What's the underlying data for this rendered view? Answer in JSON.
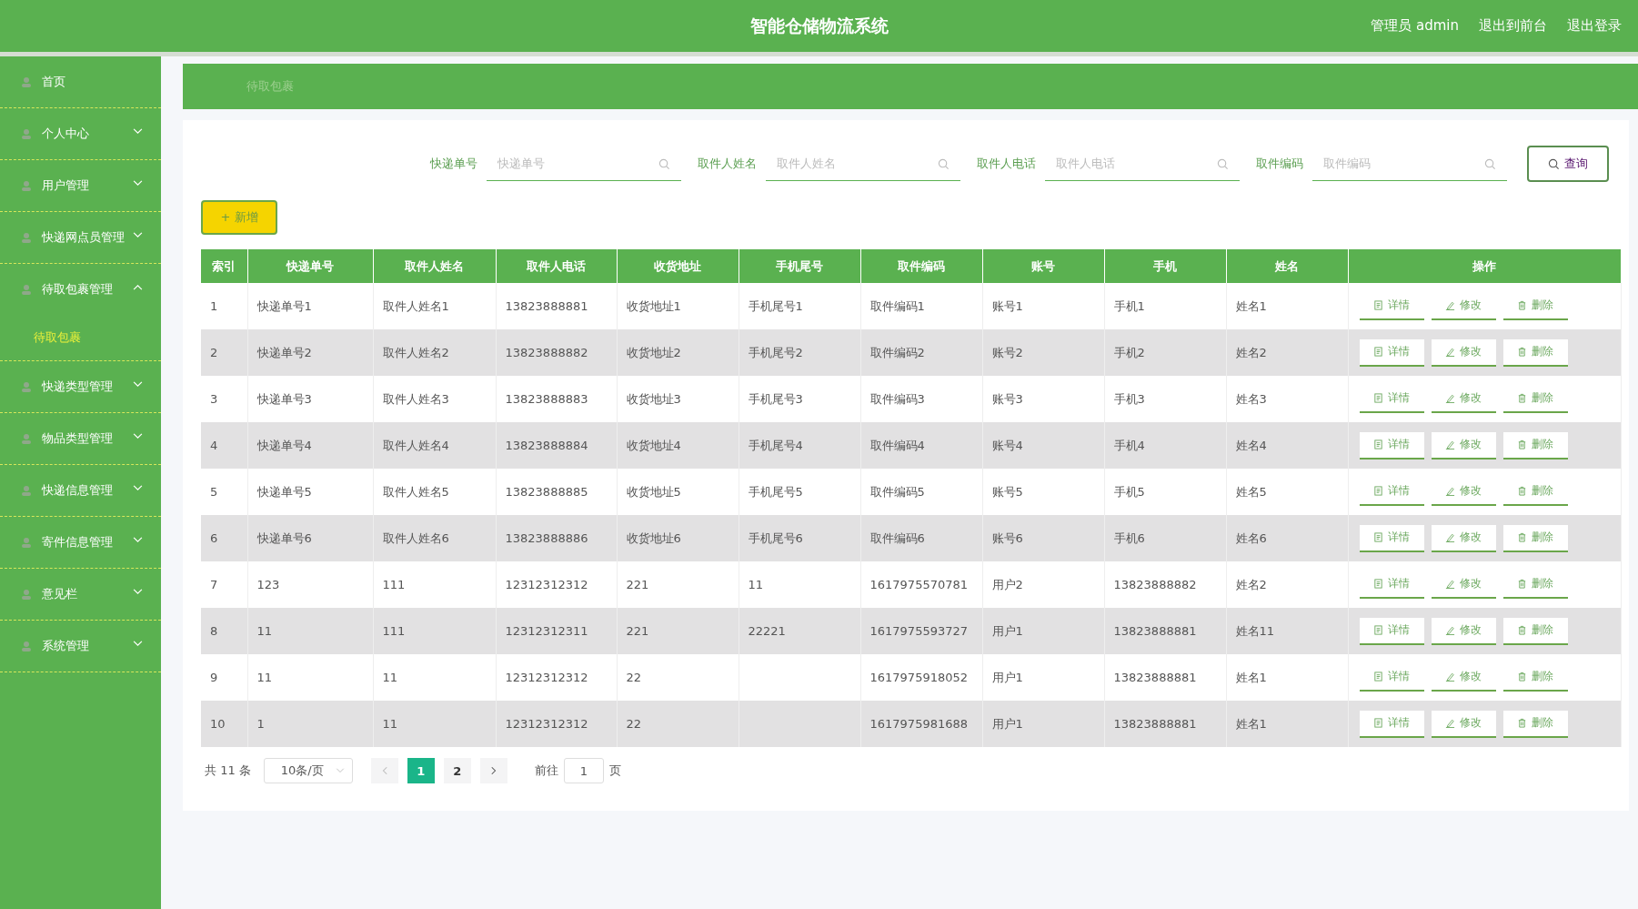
{
  "header": {
    "title": "智能仓储物流系统",
    "links": [
      "管理员 admin",
      "退出到前台",
      "退出登录"
    ]
  },
  "sidebar": {
    "items": [
      {
        "label": "首页",
        "kind": "link"
      },
      {
        "label": "个人中心",
        "kind": "submenu",
        "expanded": false
      },
      {
        "label": "用户管理",
        "kind": "submenu",
        "expanded": false
      },
      {
        "label": "快递网点员管理",
        "kind": "submenu",
        "expanded": false
      },
      {
        "label": "待取包裹管理",
        "kind": "submenu",
        "expanded": true,
        "children": [
          {
            "label": "待取包裹",
            "selected": true
          }
        ]
      },
      {
        "label": "快递类型管理",
        "kind": "submenu",
        "expanded": false
      },
      {
        "label": "物品类型管理",
        "kind": "submenu",
        "expanded": false
      },
      {
        "label": "快递信息管理",
        "kind": "submenu",
        "expanded": false
      },
      {
        "label": "寄件信息管理",
        "kind": "submenu",
        "expanded": false
      },
      {
        "label": "意见栏",
        "kind": "submenu",
        "expanded": false
      },
      {
        "label": "系统管理",
        "kind": "submenu",
        "expanded": false
      }
    ]
  },
  "breadcrumb": "待取包裹",
  "search": {
    "fields": [
      {
        "label": "快递单号",
        "placeholder": "快递单号"
      },
      {
        "label": "取件人姓名",
        "placeholder": "取件人姓名"
      },
      {
        "label": "取件人电话",
        "placeholder": "取件人电话"
      },
      {
        "label": "取件编码",
        "placeholder": "取件编码"
      }
    ],
    "button": "查询"
  },
  "add_button": "+ 新增",
  "table": {
    "columns": [
      "索引",
      "快递单号",
      "取件人姓名",
      "取件人电话",
      "收货地址",
      "手机尾号",
      "取件编码",
      "账号",
      "手机",
      "姓名",
      "操作"
    ],
    "rows": [
      {
        "cells": [
          "1",
          "快递单号1",
          "取件人姓名1",
          "13823888881",
          "收货地址1",
          "手机尾号1",
          "取件编码1",
          "账号1",
          "手机1",
          "姓名1"
        ],
        "actions": [
          "详情",
          "修改",
          "删除"
        ]
      },
      {
        "cells": [
          "2",
          "快递单号2",
          "取件人姓名2",
          "13823888882",
          "收货地址2",
          "手机尾号2",
          "取件编码2",
          "账号2",
          "手机2",
          "姓名2"
        ],
        "actions": [
          "详情",
          "修改",
          "删除"
        ]
      },
      {
        "cells": [
          "3",
          "快递单号3",
          "取件人姓名3",
          "13823888883",
          "收货地址3",
          "手机尾号3",
          "取件编码3",
          "账号3",
          "手机3",
          "姓名3"
        ],
        "actions": [
          "详情",
          "修改",
          "删除"
        ]
      },
      {
        "cells": [
          "4",
          "快递单号4",
          "取件人姓名4",
          "13823888884",
          "收货地址4",
          "手机尾号4",
          "取件编码4",
          "账号4",
          "手机4",
          "姓名4"
        ],
        "actions": [
          "详情",
          "修改",
          "删除"
        ]
      },
      {
        "cells": [
          "5",
          "快递单号5",
          "取件人姓名5",
          "13823888885",
          "收货地址5",
          "手机尾号5",
          "取件编码5",
          "账号5",
          "手机5",
          "姓名5"
        ],
        "actions": [
          "详情",
          "修改",
          "删除"
        ]
      },
      {
        "cells": [
          "6",
          "快递单号6",
          "取件人姓名6",
          "13823888886",
          "收货地址6",
          "手机尾号6",
          "取件编码6",
          "账号6",
          "手机6",
          "姓名6"
        ],
        "actions": [
          "详情",
          "修改",
          "删除"
        ]
      },
      {
        "cells": [
          "7",
          "123",
          "111",
          "12312312312",
          "221",
          "11",
          "1617975570781",
          "用户2",
          "13823888882",
          "姓名2"
        ],
        "actions": [
          "详情",
          "修改",
          "删除"
        ]
      },
      {
        "cells": [
          "8",
          "11",
          "111",
          "12312312311",
          "221",
          "22221",
          "1617975593727",
          "用户1",
          "13823888881",
          "姓名11"
        ],
        "actions": [
          "详情",
          "修改",
          "删除"
        ]
      },
      {
        "cells": [
          "9",
          "11",
          "11",
          "12312312312",
          "22",
          "",
          "1617975918052",
          "用户1",
          "13823888881",
          "姓名1"
        ],
        "actions": [
          "详情",
          "修改",
          "删除"
        ]
      },
      {
        "cells": [
          "10",
          "1",
          "11",
          "12312312312",
          "22",
          "",
          "1617975981688",
          "用户1",
          "13823888881",
          "姓名1"
        ],
        "actions": [
          "详情",
          "修改",
          "删除"
        ]
      }
    ]
  },
  "pagination": {
    "total": "共 11 条",
    "page_size": "10条/页",
    "pages": [
      {
        "label": "1",
        "selected": true
      },
      {
        "label": "2",
        "selected": false
      }
    ],
    "goto_label": "前往",
    "goto_value": "1",
    "goto_suffix": "页"
  }
}
